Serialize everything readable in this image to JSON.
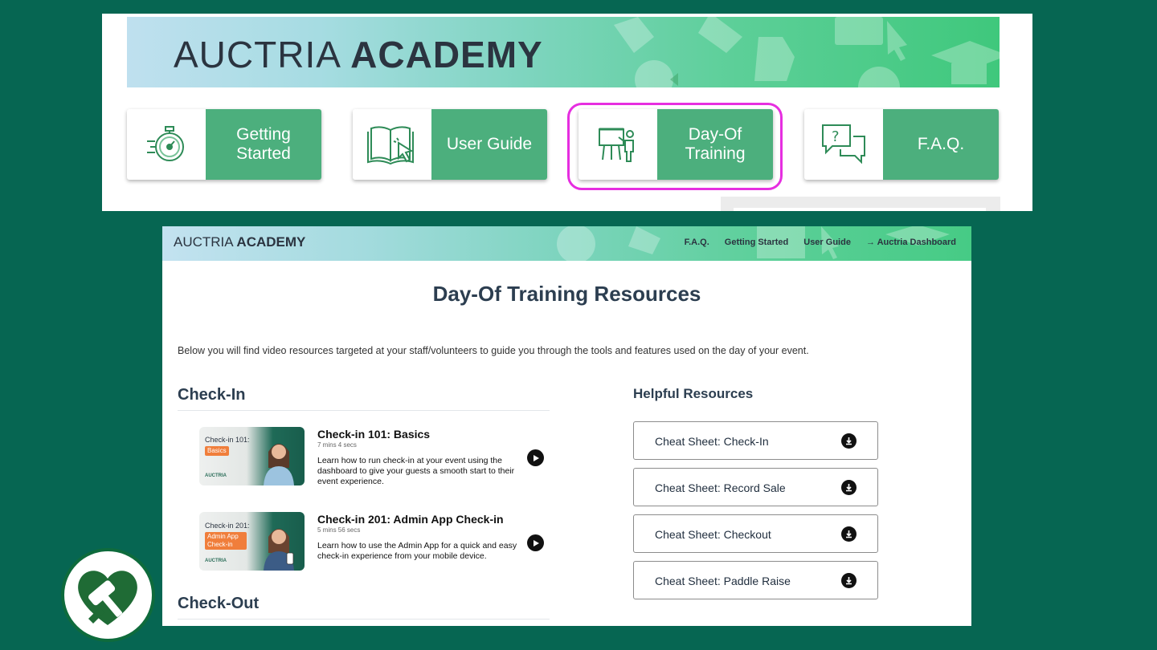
{
  "top": {
    "brand_light": "AUCTRIA",
    "brand_bold": "ACADEMY",
    "tiles": [
      {
        "label": "Getting Started",
        "icon": "stopwatch-icon"
      },
      {
        "label": "User Guide",
        "icon": "book-cursor-icon"
      },
      {
        "label": "Day-Of Training",
        "icon": "presentation-icon"
      },
      {
        "label": "F.A.Q.",
        "icon": "question-chat-icon"
      }
    ]
  },
  "nav": {
    "brand_light": "AUCTRIA",
    "brand_bold": "ACADEMY",
    "links": [
      "F.A.Q.",
      "Getting Started",
      "User Guide",
      "→ Auctria Dashboard"
    ]
  },
  "page": {
    "title": "Day-Of Training Resources",
    "intro": "Below you will find video resources targeted at your staff/volunteers to guide you through the tools and features used on the day of your event."
  },
  "sections": {
    "checkin_title": "Check-In",
    "checkout_title": "Check-Out",
    "videos": [
      {
        "thumb_title": "Check-in 101:",
        "thumb_tag": "Basics",
        "thumb_logo": "AUCTRIA",
        "title": "Check-in 101: Basics",
        "duration": "7 mins 4 secs",
        "description": "Learn how to run check-in at your event using the dashboard to give your guests a smooth start to their event experience."
      },
      {
        "thumb_title": "Check-in 201:",
        "thumb_tag": "Admin App Check-in",
        "thumb_logo": "AUCTRIA",
        "title": "Check-in 201: Admin App Check-in",
        "duration": "5 mins 56 secs",
        "description": "Learn how to use the Admin App for a quick and easy check-in experience from your mobile device."
      }
    ]
  },
  "helpful": {
    "title": "Helpful Resources",
    "items": [
      "Cheat Sheet: Check-In",
      "Cheat Sheet: Record Sale",
      "Cheat Sheet: Checkout",
      "Cheat Sheet: Paddle Raise"
    ]
  },
  "colors": {
    "background": "#066652",
    "tile_green": "#4caf7d",
    "highlight": "#e62ee0",
    "tag_orange": "#f07e3b"
  }
}
